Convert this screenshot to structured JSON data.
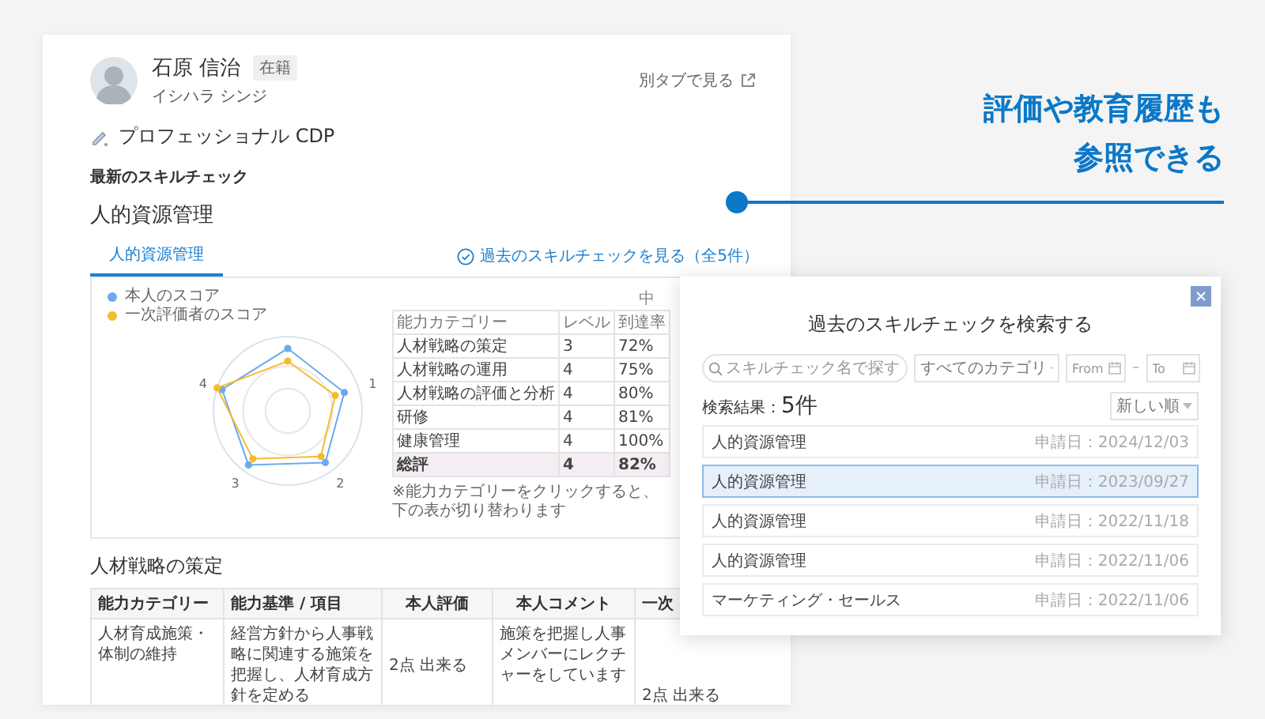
{
  "employee": {
    "name": "石原 信治",
    "status_badge": "在籍",
    "kana": "イシハラ シンジ",
    "open_in_tab_link": "別タブで見る"
  },
  "program": {
    "title": "プロフェッショナル CDP"
  },
  "section_label": "最新のスキルチェック",
  "skill_check_title": "人的資源管理",
  "tabs": [
    {
      "label": "人的資源管理",
      "selected": true
    }
  ],
  "past_checks_link": "過去のスキルチェックを見る（全5件）",
  "summary_panel": {
    "corner_text": "中",
    "legend": [
      {
        "label": "本人のスコア",
        "color": "#6aaaf0"
      },
      {
        "label": "一次評価者のスコア",
        "color": "#f5bc2e"
      }
    ],
    "axis_labels": [
      "1",
      "2",
      "3",
      "4"
    ],
    "columns": [
      "能力カテゴリー",
      "レベル",
      "到達率"
    ],
    "rows": [
      {
        "kind": "item",
        "category": "人材戦略の策定",
        "grade": "3",
        "rate": "72%"
      },
      {
        "kind": "item",
        "category": "人材戦略の運用",
        "grade": "4",
        "rate": "75%"
      },
      {
        "kind": "item",
        "category": "人材戦略の評価と分析",
        "grade": "4",
        "rate": "80%"
      },
      {
        "kind": "item",
        "category": "研修",
        "grade": "4",
        "rate": "81%"
      },
      {
        "kind": "item",
        "category": "健康管理",
        "grade": "4",
        "rate": "100%"
      },
      {
        "kind": "total",
        "category": "総評",
        "grade": "4",
        "rate": "82%"
      }
    ],
    "note": "※能力カテゴリーをクリックすると、下の表が切り替わります"
  },
  "detail": {
    "title": "人材戦略の策定",
    "columns": [
      "能力カテゴリー",
      "能力基準 / 項目",
      "本人評価",
      "本人コメント",
      "一次"
    ],
    "rows": [
      {
        "cells": [
          "人材育成施策・体制の維持",
          "経営方針から人事戦略に関連する施策を把握し、人材育成方針を定める",
          "2点 出来る",
          "施策を把握し人事メンバーにレクチャーをしています",
          "2点 出来る"
        ]
      }
    ]
  },
  "modal": {
    "title": "過去のスキルチェックを検索する",
    "search_placeholder": "スキルチェック名で探す",
    "category_select": "すべてのカテゴリ",
    "date_from_placeholder": "From",
    "date_separator": "–",
    "date_to_placeholder": "To",
    "results_label": "検索結果：",
    "results_count": "5件",
    "sort_select": "新しい順",
    "results": [
      {
        "name": "人的資源管理",
        "date": "申請日：2024/12/03",
        "selected": false
      },
      {
        "name": "人的資源管理",
        "date": "申請日：2023/09/27",
        "selected": true
      },
      {
        "name": "人的資源管理",
        "date": "申請日：2022/11/18",
        "selected": false
      },
      {
        "name": "人的資源管理",
        "date": "申請日：2022/11/06",
        "selected": false
      },
      {
        "name": "マーケティング・セールス",
        "date": "申請日：2022/11/06",
        "selected": false
      }
    ]
  },
  "callout": {
    "lines": [
      "評価や教育履歴も",
      "参照できる"
    ]
  }
}
